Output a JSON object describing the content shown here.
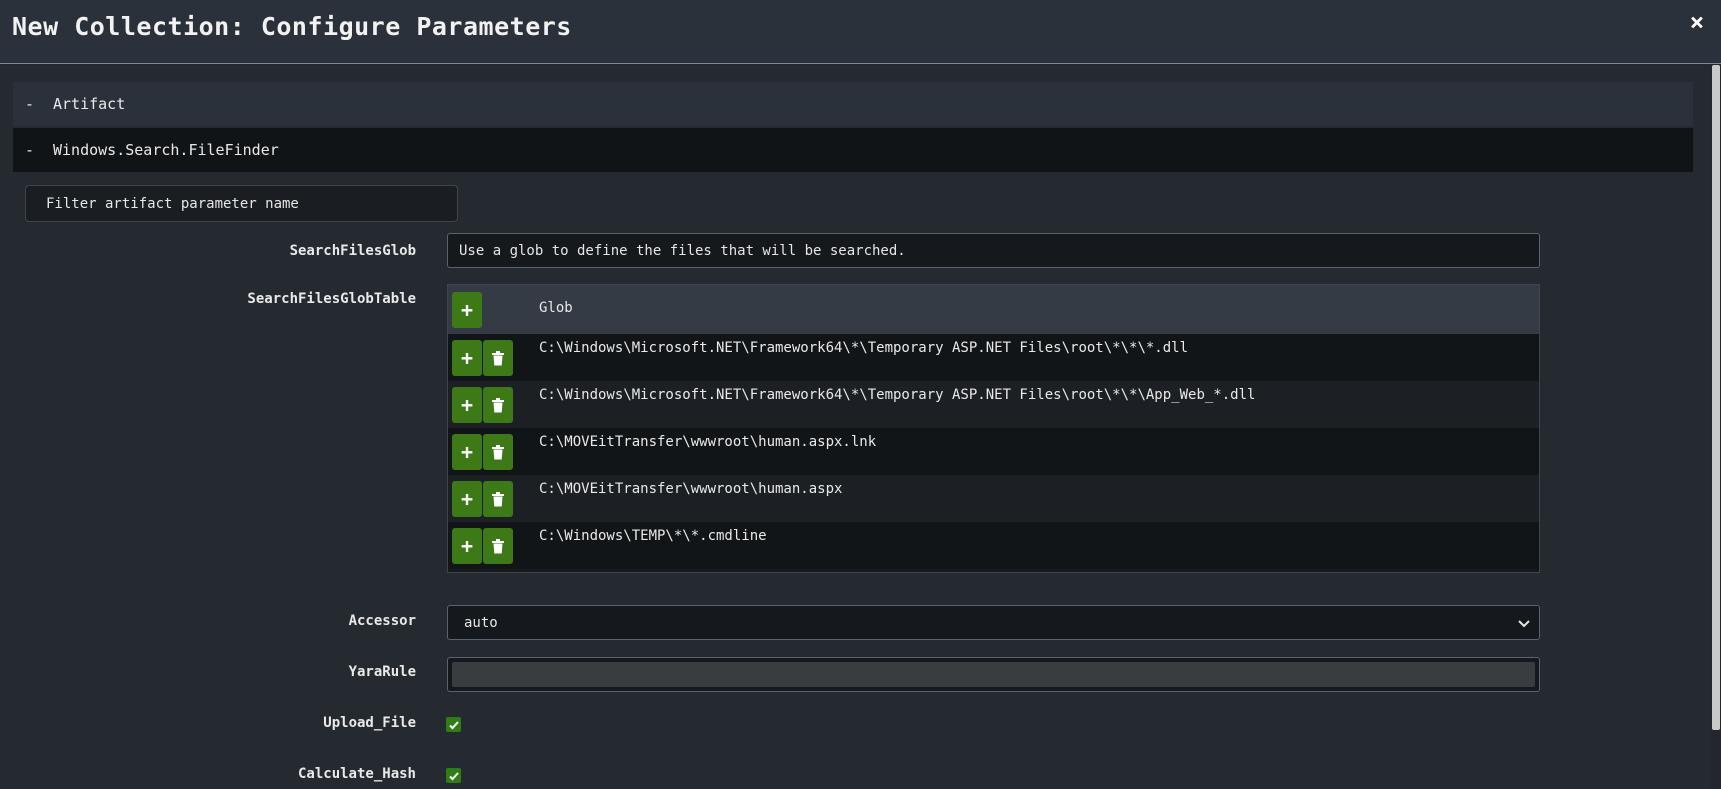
{
  "header": {
    "title": "New Collection: Configure Parameters",
    "close_glyph": "×"
  },
  "sections": {
    "artifact": {
      "toggle": "-",
      "label": "Artifact"
    },
    "finder": {
      "toggle": "-",
      "label": "Windows.Search.FileFinder"
    }
  },
  "filter": {
    "placeholder": "Filter artifact parameter name"
  },
  "params": {
    "search_files_glob": {
      "label": "SearchFilesGlob",
      "value": "Use a glob to define the files that will be searched."
    },
    "glob_table": {
      "label": "SearchFilesGlobTable",
      "column": "Glob",
      "rows": [
        "C:\\Windows\\Microsoft.NET\\Framework64\\*\\Temporary ASP.NET Files\\root\\*\\*\\*.dll",
        "C:\\Windows\\Microsoft.NET\\Framework64\\*\\Temporary ASP.NET Files\\root\\*\\*\\App_Web_*.dll",
        "C:\\MOVEitTransfer\\wwwroot\\human.aspx.lnk",
        "C:\\MOVEitTransfer\\wwwroot\\human.aspx",
        "C:\\Windows\\TEMP\\*\\*.cmdline"
      ]
    },
    "accessor": {
      "label": "Accessor",
      "value": "auto"
    },
    "yara_rule": {
      "label": "YaraRule",
      "value": ""
    },
    "upload_file": {
      "label": "Upload_File",
      "checked": true
    },
    "calculate_hash": {
      "label": "Calculate_Hash",
      "checked": true
    }
  },
  "colors": {
    "accent": "#3d7a17",
    "background": "#252a30",
    "header": "#2b313a"
  },
  "icons": {
    "add": "plus-icon",
    "delete": "trash-icon",
    "close": "close-icon",
    "dropdown": "chevron-down-icon",
    "check": "check-icon"
  }
}
